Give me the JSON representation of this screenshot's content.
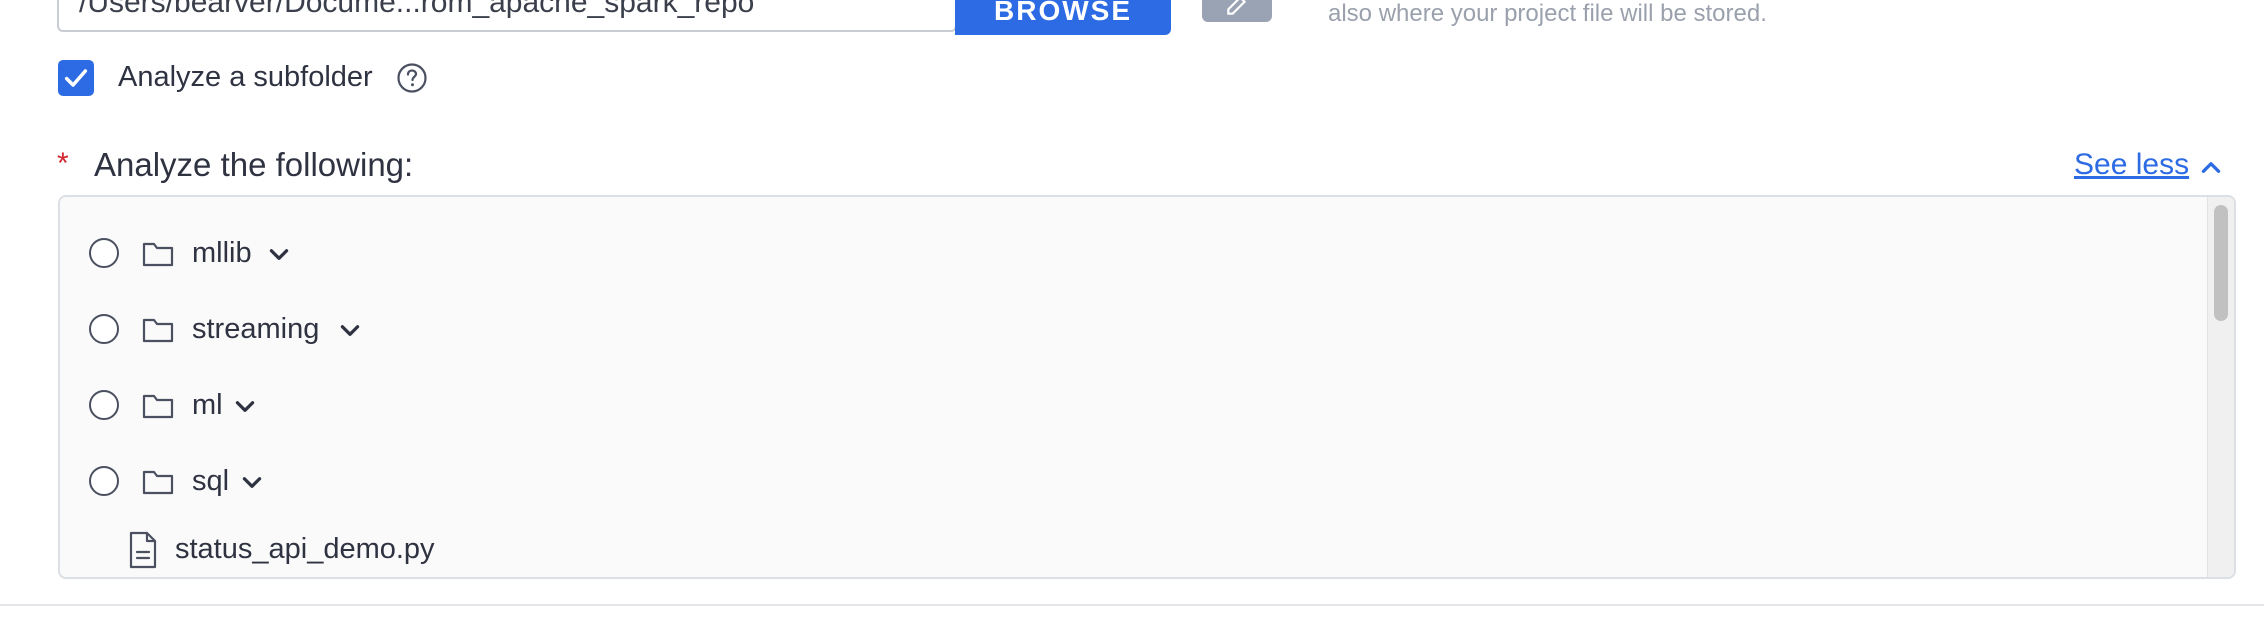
{
  "project": {
    "path_value": "/Users/bearver/Docume...rom_apache_spark_repo",
    "browse_label": "BROWSE",
    "helper_text": "also where your project file will be stored."
  },
  "subfolder": {
    "label": "Analyze a subfolder",
    "checked": true
  },
  "analyze": {
    "title": "Analyze the following:",
    "required_mark": "*",
    "see_less_label": "See less"
  },
  "tree": {
    "items": [
      {
        "label": "mllib",
        "type": "folder"
      },
      {
        "label": "streaming",
        "type": "folder"
      },
      {
        "label": "ml",
        "type": "folder"
      },
      {
        "label": "sql",
        "type": "folder"
      },
      {
        "label": "status_api_demo.py",
        "type": "file"
      }
    ]
  },
  "colors": {
    "accent": "#2d6be4",
    "required": "#d4262f",
    "muted_text": "#9aa1ad"
  },
  "icons": {
    "edit": "pencil-icon",
    "help": "question-circle-icon",
    "folder": "folder-icon",
    "file": "file-icon",
    "expand": "chevron-down-icon",
    "collapse": "chevron-up-icon",
    "check": "checkmark-icon"
  }
}
